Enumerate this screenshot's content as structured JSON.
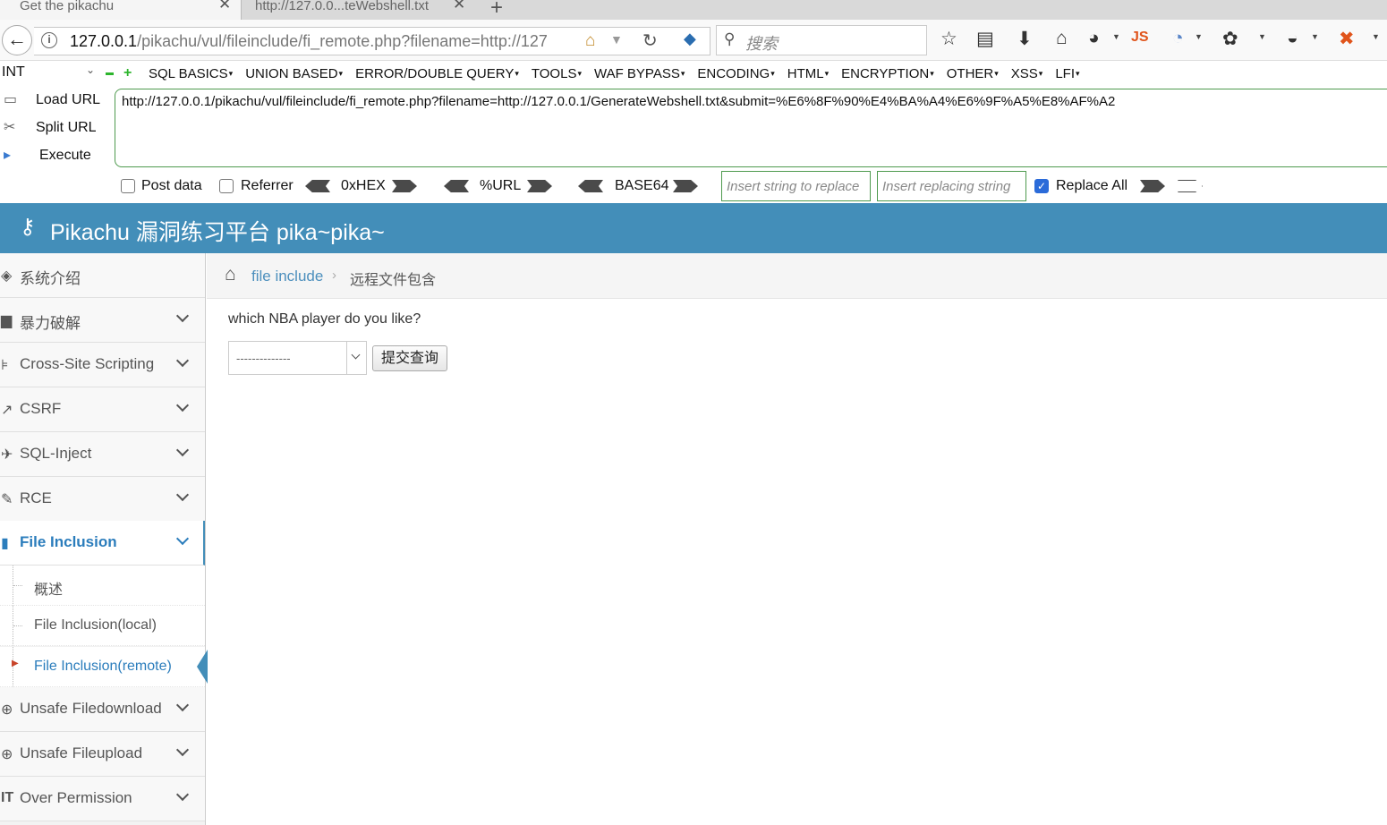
{
  "tabs": [
    {
      "label": "Get the pikachu",
      "active": true
    },
    {
      "label": "http://127.0.0...teWebshell.txt",
      "active": false
    }
  ],
  "nav": {
    "url_host": "127.0.0.1",
    "url_path": "/pikachu/vul/fileinclude/fi_remote.php?filename=http://127",
    "search_placeholder": "搜索"
  },
  "hackbar": {
    "int_select": "INT",
    "menus": [
      "SQL BASICS",
      "UNION BASED",
      "ERROR/DOUBLE QUERY",
      "TOOLS",
      "WAF BYPASS",
      "ENCODING",
      "HTML",
      "ENCRYPTION",
      "OTHER",
      "XSS",
      "LFI"
    ],
    "commands": {
      "load": "Load URL",
      "split": "Split URL",
      "execute": "Execute"
    },
    "url_value": "http://127.0.0.1/pikachu/vul/fileinclude/fi_remote.php?filename=http://127.0.0.1/GenerateWebshell.txt&submit=%E6%8F%90%E4%BA%A4%E6%9F%A5%E8%AF%A2",
    "post_data_label": "Post data",
    "referrer_label": "Referrer",
    "hex_label": "0xHEX",
    "url_label": "%URL",
    "base64_label": "BASE64",
    "replace_placeholder": "Insert string to replace",
    "replacing_placeholder": "Insert replacing string",
    "replace_all_label": "Replace All"
  },
  "site": {
    "title": "Pikachu 漏洞练习平台 pika~pika~",
    "accent": "#438eb9"
  },
  "sidebar": {
    "items": [
      {
        "label": "系统介绍",
        "icon": "tag-icon"
      },
      {
        "label": "暴力破解",
        "icon": "lock-icon"
      },
      {
        "label": "Cross-Site Scripting",
        "icon": "sitemap-icon"
      },
      {
        "label": "CSRF",
        "icon": "share-icon"
      },
      {
        "label": "SQL-Inject",
        "icon": "fighter-jet-icon"
      },
      {
        "label": "RCE",
        "icon": "pencil-icon"
      },
      {
        "label": "File Inclusion",
        "icon": "file-icon"
      },
      {
        "label": "Unsafe Filedownload",
        "icon": "download-icon"
      },
      {
        "label": "Unsafe Fileupload",
        "icon": "upload-icon"
      },
      {
        "label": "Over Permission",
        "icon": "text-height-icon"
      }
    ],
    "sub_items": [
      "概述",
      "File Inclusion(local)",
      "File Inclusion(remote)"
    ]
  },
  "breadcrumb": {
    "link": "file include",
    "current": "远程文件包含"
  },
  "main": {
    "question": "which NBA player do you like?",
    "select_value": "--------------",
    "submit_label": "提交查询"
  }
}
